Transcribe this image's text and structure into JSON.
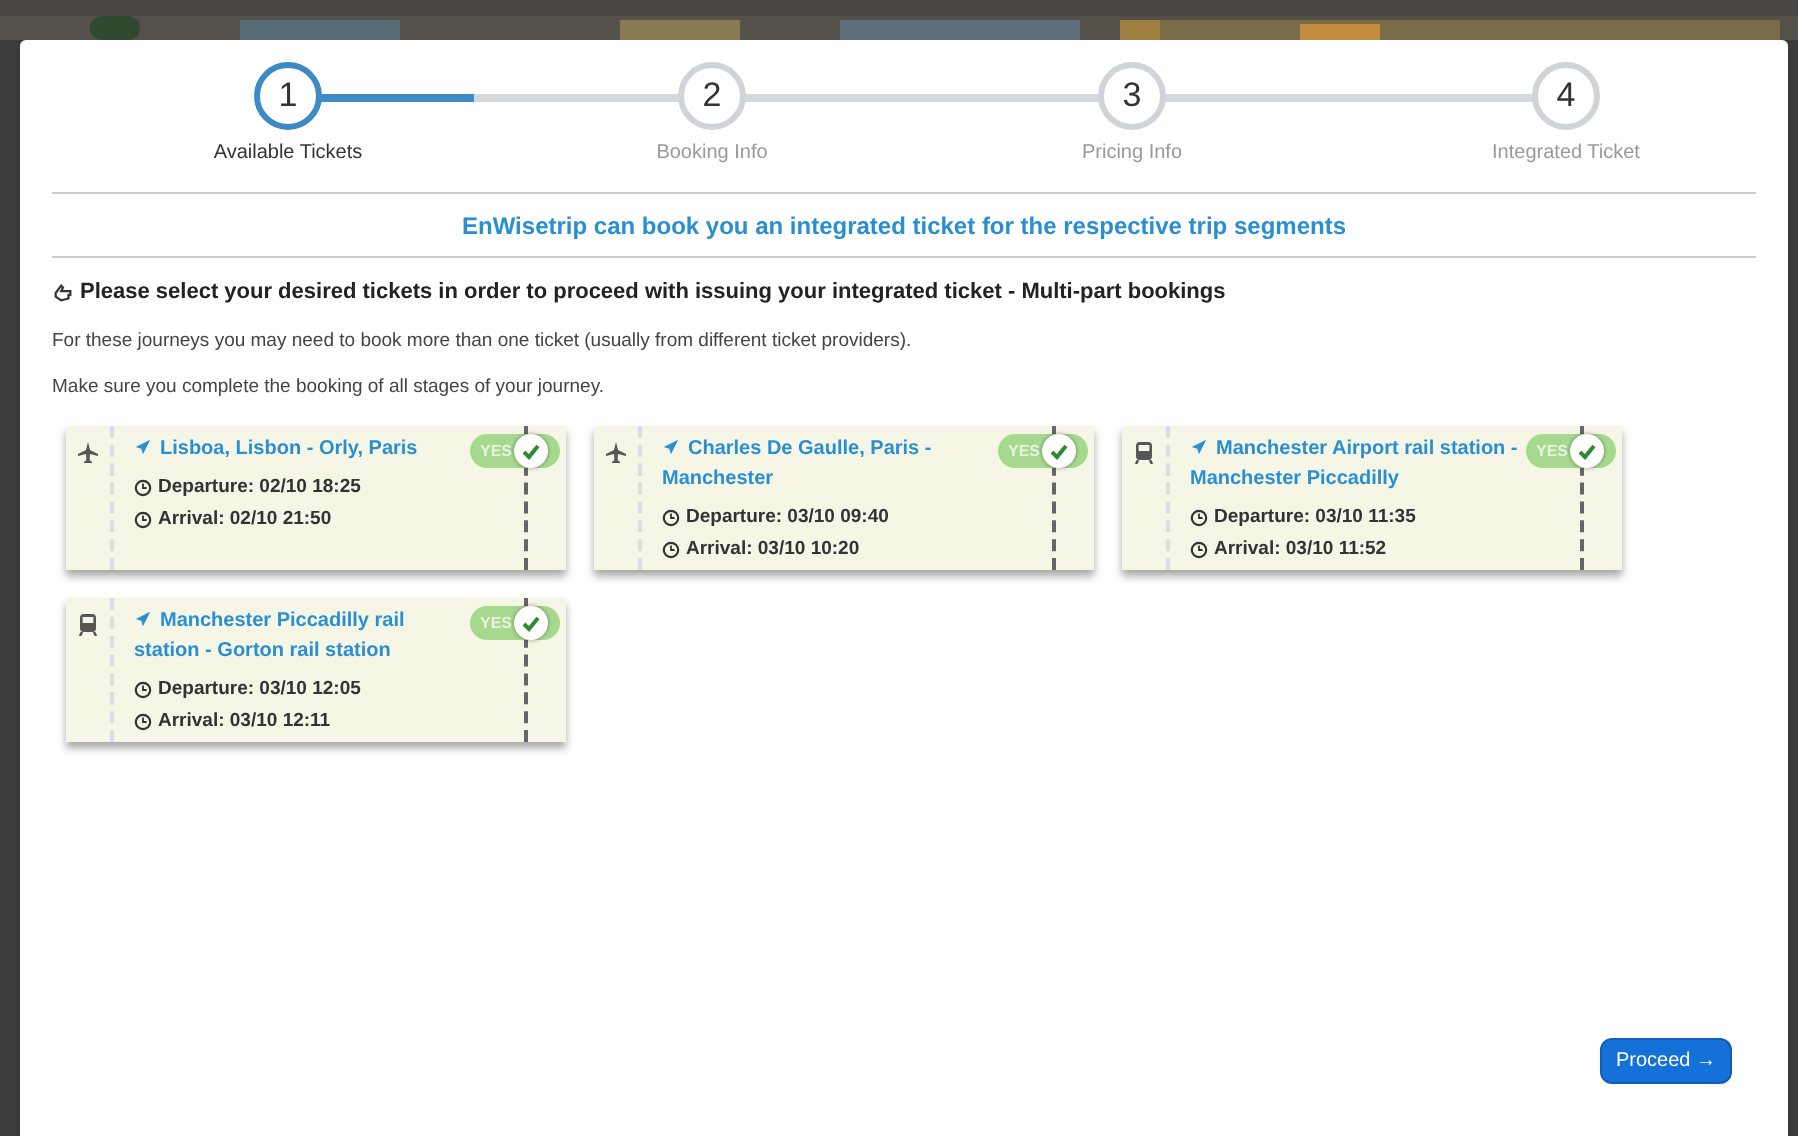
{
  "stepper": {
    "level": 0.17,
    "steps": [
      {
        "number": "1",
        "label": "Available Tickets",
        "selected": true
      },
      {
        "number": "2",
        "label": "Booking Info",
        "selected": false
      },
      {
        "number": "3",
        "label": "Pricing Info",
        "selected": false
      },
      {
        "number": "4",
        "label": "Integrated Ticket",
        "selected": false
      }
    ]
  },
  "banner": "EnWisetrip can book you an integrated ticket for the respective trip segments",
  "heading": "Please select your desired tickets in order to proceed with issuing your integrated ticket - Multi-part bookings",
  "notes": [
    "For these journeys you may need to book more than one ticket (usually from different ticket providers).",
    "Make sure you complete the booking of all stages of your journey."
  ],
  "tickets": [
    {
      "kind": "flight",
      "route": "Lisboa, Lisbon - Orly, Paris",
      "departure": "Departure: 02/10 18:25",
      "arrival": "Arrival: 02/10 21:50",
      "toggle": "YES",
      "on": true
    },
    {
      "kind": "flight",
      "route": "Charles De Gaulle, Paris - Manchester",
      "departure": "Departure: 03/10 09:40",
      "arrival": "Arrival: 03/10 10:20",
      "toggle": "YES",
      "on": true
    },
    {
      "kind": "train",
      "route": "Manchester Airport rail station - Manchester Piccadilly",
      "departure": "Departure: 03/10 11:35",
      "arrival": "Arrival: 03/10 11:52",
      "toggle": "YES",
      "on": true
    },
    {
      "kind": "train",
      "route": "Manchester Piccadilly rail station - Gorton rail station",
      "departure": "Departure: 03/10 12:05",
      "arrival": "Arrival: 03/10 12:11",
      "toggle": "YES",
      "on": true
    }
  ],
  "proceed": "Proceed →"
}
